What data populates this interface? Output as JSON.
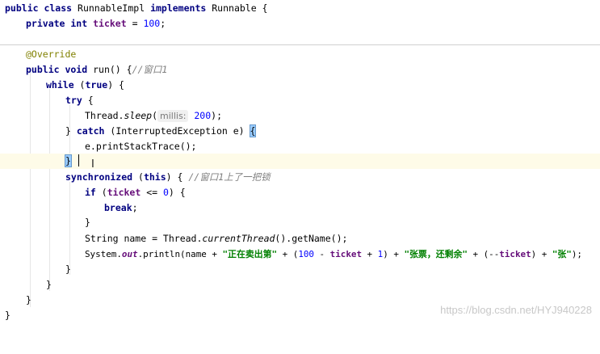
{
  "code": {
    "l1": {
      "kw1": "public class",
      "name": "RunnableImpl",
      "kw2": "implements",
      "rest": "Runnable {"
    },
    "l2": {
      "kw": "private int",
      "field": "ticket",
      "op": " = ",
      "num": "100",
      "end": ";"
    },
    "l3": {
      "ann": "@Override"
    },
    "l4": {
      "kw": "public void",
      "rest": "run() {",
      "cmt": "//窗口1"
    },
    "l5": {
      "kw": "while",
      "open": " (",
      "kw2": "true",
      "close": ") {"
    },
    "l6": {
      "kw": "try",
      "rest": " {"
    },
    "l7": {
      "pre": "Thread.",
      "method": "sleep",
      "open": "(",
      "hint": "millis:",
      "num": "200",
      "end": ");"
    },
    "l8": {
      "pre": "} ",
      "kw": "catch",
      "rest": " (InterruptedException e) ",
      "brace": "{"
    },
    "l9": {
      "text": "e.printStackTrace();"
    },
    "l10": {
      "brace": "}"
    },
    "l11": {
      "kw": "synchronized",
      "open": " (",
      "kw2": "this",
      "rest": ") { ",
      "cmt": "//窗口1上了一把锁"
    },
    "l12": {
      "kw": "if",
      "open": " (",
      "field": "ticket",
      "op": " <= ",
      "num": "0",
      "end": ") {"
    },
    "l13": {
      "kw": "break",
      "end": ";"
    },
    "l14": {
      "text": "}"
    },
    "l15": {
      "pre": "String name = Thread.",
      "method": "currentThread",
      "end": "().getName();"
    },
    "l16": {
      "pre": "System.",
      "sfield": "out",
      "p2": ".println(name + ",
      "s1": "\"正在卖出第\"",
      "p3": " + (",
      "n1": "100",
      "p4": " - ",
      "f1": "ticket",
      "p5": " + ",
      "n2": "1",
      "p6": ") + ",
      "s2": "\"张票，还剩余\"",
      "p7": " + (--",
      "f2": "ticket",
      "p8": ") + ",
      "s3": "\"张\"",
      "p9": ");"
    },
    "l17": {
      "text": "}"
    },
    "l18": {
      "text": "}"
    },
    "l19": {
      "text": "}"
    },
    "l20": {
      "text": "}"
    }
  },
  "watermark": "https://blog.csdn.net/HYJ940228",
  "colors": {
    "keyword": "#000080",
    "field": "#660e7a",
    "number": "#0000ff",
    "string": "#008000",
    "annotation": "#808000",
    "highlight_line": "#fefbe8"
  }
}
